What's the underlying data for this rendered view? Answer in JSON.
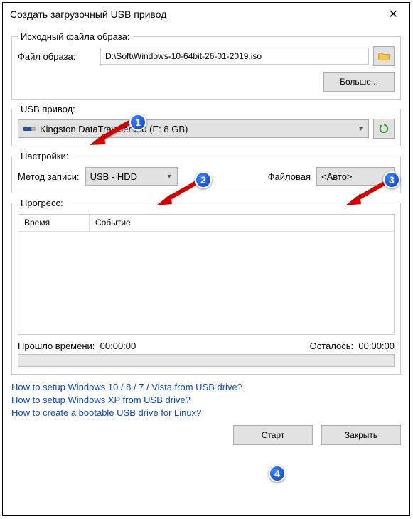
{
  "window": {
    "title": "Создать загрузочный USB привод"
  },
  "imagefile": {
    "group_title": "Исходный файла образа:",
    "label": "Файл образа:",
    "value": "D:\\Soft\\Windows-10-64bit-26-01-2019.iso",
    "more_btn": "Больше..."
  },
  "usb": {
    "group_title": "USB привод:",
    "selected": "Kingston DataTraveler 2.0 (E: 8 GB)"
  },
  "settings": {
    "group_title": "Настройки:",
    "write_method_label": "Метод записи:",
    "write_method_value": "USB - HDD",
    "filesystem_label": "Файловая",
    "filesystem_value": "<Авто>"
  },
  "progress": {
    "group_title": "Прогресс:",
    "col_time": "Время",
    "col_event": "Событие",
    "elapsed_label": "Прошло времени:",
    "elapsed_value": "00:00:00",
    "remaining_label": "Осталось:",
    "remaining_value": "00:00:00"
  },
  "links": {
    "win_guide": "How to setup Windows 10 / 8 / 7 / Vista from USB drive?",
    "xp_guide": "How to setup Windows XP from USB drive?",
    "linux_guide": "How to create a bootable USB drive for Linux?"
  },
  "footer": {
    "start": "Старт",
    "close": "Закрыть"
  },
  "badges": {
    "b1": "1",
    "b2": "2",
    "b3": "3",
    "b4": "4"
  }
}
